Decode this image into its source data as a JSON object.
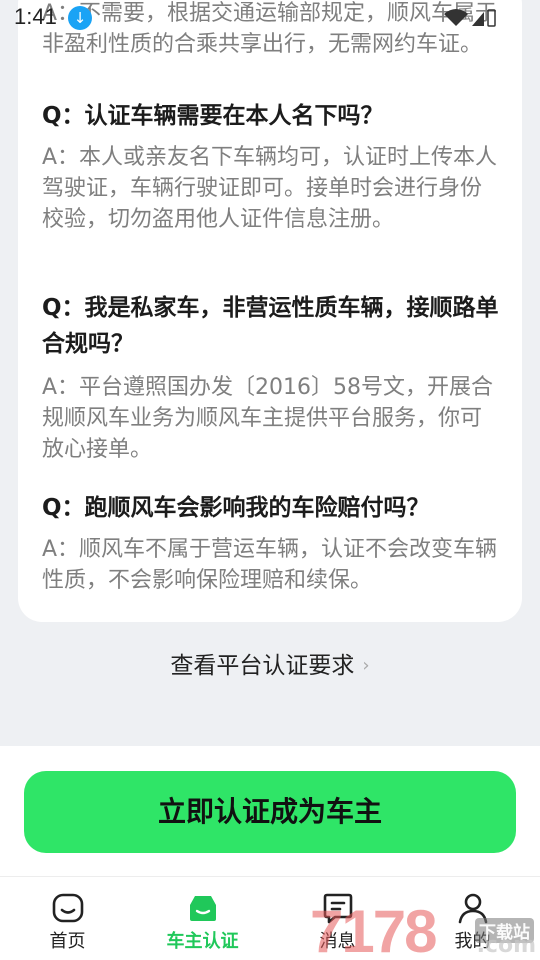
{
  "status_bar": {
    "time": "1:41"
  },
  "faq": {
    "items": [
      {
        "question": "",
        "answer": "A：不需要，根据交通运输部规定，顺风车属于非盈利性质的合乘共享出行，无需网约车证。"
      },
      {
        "question": "Q：认证车辆需要在本人名下吗？",
        "answer": "A：本人或亲友名下车辆均可，认证时上传本人驾驶证，车辆行驶证即可。接单时会进行身份校验，切勿盗用他人证件信息注册。"
      },
      {
        "question": "Q：我是私家车，非营运性质车辆，接顺路单合规吗？",
        "answer": "A：平台遵照国办发〔2016〕58号文，开展合规顺风车业务为顺风车主提供平台服务，你可放心接单。"
      },
      {
        "question": "Q：跑顺风车会影响我的车险赔付吗？",
        "answer": "A：顺风车不属于营运车辆，认证不会改变车辆性质，不会影响保险理赔和续保。"
      }
    ]
  },
  "platform_link": {
    "label": "查看平台认证要求",
    "chevron": "›"
  },
  "cta": {
    "label": "立即认证成为车主"
  },
  "tabs": [
    {
      "label": "首页",
      "icon": "home-icon"
    },
    {
      "label": "车主认证",
      "icon": "car-icon"
    },
    {
      "label": "消息",
      "icon": "message-icon"
    },
    {
      "label": "我的",
      "icon": "profile-icon"
    }
  ],
  "watermark": {
    "number": "7178",
    "text": "下载站",
    "suffix": ".com"
  },
  "colors": {
    "accent": "#2fe567",
    "active_tab": "#20c85a",
    "card": "#ffffff",
    "page_bg": "#eef0f3"
  }
}
